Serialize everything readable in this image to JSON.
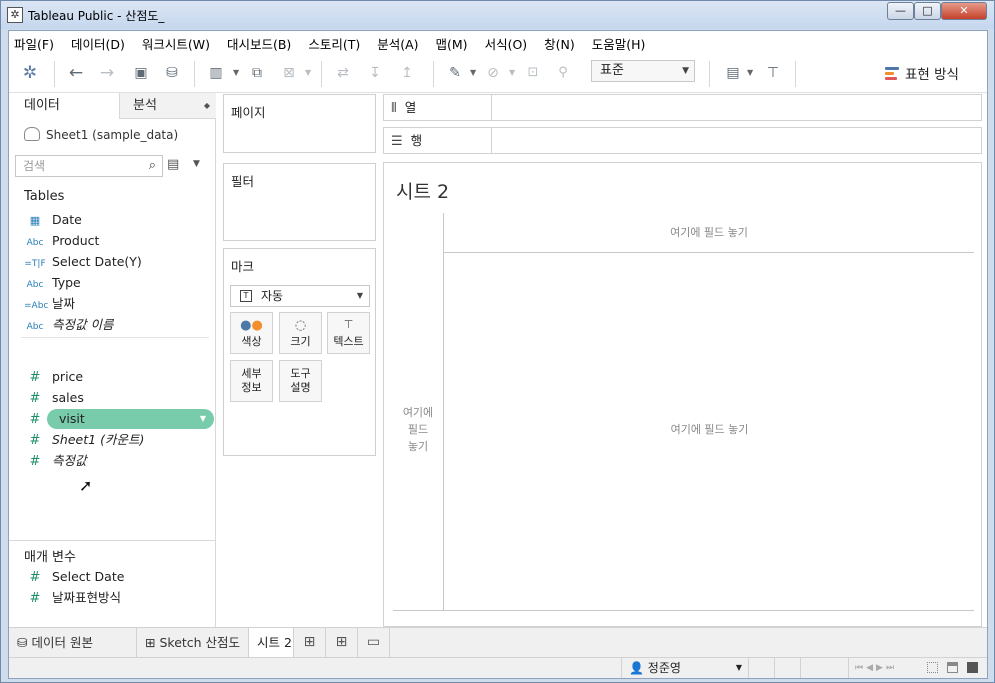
{
  "window": {
    "title": "Tableau Public - 산점도_",
    "buttons": {
      "minimize": "—",
      "maximize": "□",
      "close": "✕"
    }
  },
  "menu": [
    "파일(F)",
    "데이터(D)",
    "워크시트(W)",
    "대시보드(B)",
    "스토리(T)",
    "분석(A)",
    "맵(M)",
    "서식(O)",
    "창(N)",
    "도움말(H)"
  ],
  "toolbar": {
    "standard_select": "표준",
    "show_me": "표현 방식"
  },
  "data_pane": {
    "tab_data": "데이터",
    "tab_analytics": "분석",
    "datasource": "Sheet1 (sample_data)",
    "search_placeholder": "검색",
    "tables_heading": "Tables",
    "dimensions": [
      {
        "type": "date",
        "type_glyph": "▦",
        "name": "Date"
      },
      {
        "type": "string",
        "type_glyph": "Abc",
        "name": "Product"
      },
      {
        "type": "calc-bool",
        "type_glyph": "=T|F",
        "name": "Select Date(Y)"
      },
      {
        "type": "string",
        "type_glyph": "Abc",
        "name": "Type"
      },
      {
        "type": "calc-string",
        "type_glyph": "=Abc",
        "name": "날짜"
      },
      {
        "type": "string",
        "type_glyph": "Abc",
        "name": "측정값 이름",
        "italic": true
      }
    ],
    "measures": [
      {
        "type_glyph": "#",
        "name": "price"
      },
      {
        "type_glyph": "#",
        "name": "sales"
      },
      {
        "type_glyph": "#",
        "name": "visit",
        "selected": true
      },
      {
        "type_glyph": "#",
        "name": "Sheet1 (카운트)",
        "italic": true
      },
      {
        "type_glyph": "#",
        "name": "측정값",
        "italic": true
      }
    ],
    "parameters_heading": "매개 변수",
    "parameters": [
      {
        "type_glyph": "#",
        "name": "Select Date"
      },
      {
        "type_glyph": "#",
        "name": "날짜표현방식"
      }
    ],
    "pill_color": "#78cbab"
  },
  "cards": {
    "pages": "페이지",
    "filters": "필터",
    "marks": {
      "title": "마크",
      "type": "자동",
      "buttons": [
        {
          "name": "color",
          "label": "색상"
        },
        {
          "name": "size",
          "label": "크기"
        },
        {
          "name": "text",
          "label": "텍스트"
        },
        {
          "name": "detail",
          "label_line1": "세부",
          "label_line2": "정보"
        },
        {
          "name": "tooltip",
          "label_line1": "도구",
          "label_line2": "설명"
        }
      ]
    }
  },
  "shelves": {
    "columns": "열",
    "rows": "행"
  },
  "viz": {
    "sheet_title": "시트 2",
    "drop_top": "여기에 필드 놓기",
    "drop_left_1": "여기에",
    "drop_left_2": "필드",
    "drop_left_3": "놓기",
    "drop_center": "여기에 필드 놓기"
  },
  "tabs": {
    "data_source": "데이터 원본",
    "sheet1": "Sketch 산점도",
    "sheet2": "시트 2"
  },
  "status": {
    "user": "정준영"
  }
}
